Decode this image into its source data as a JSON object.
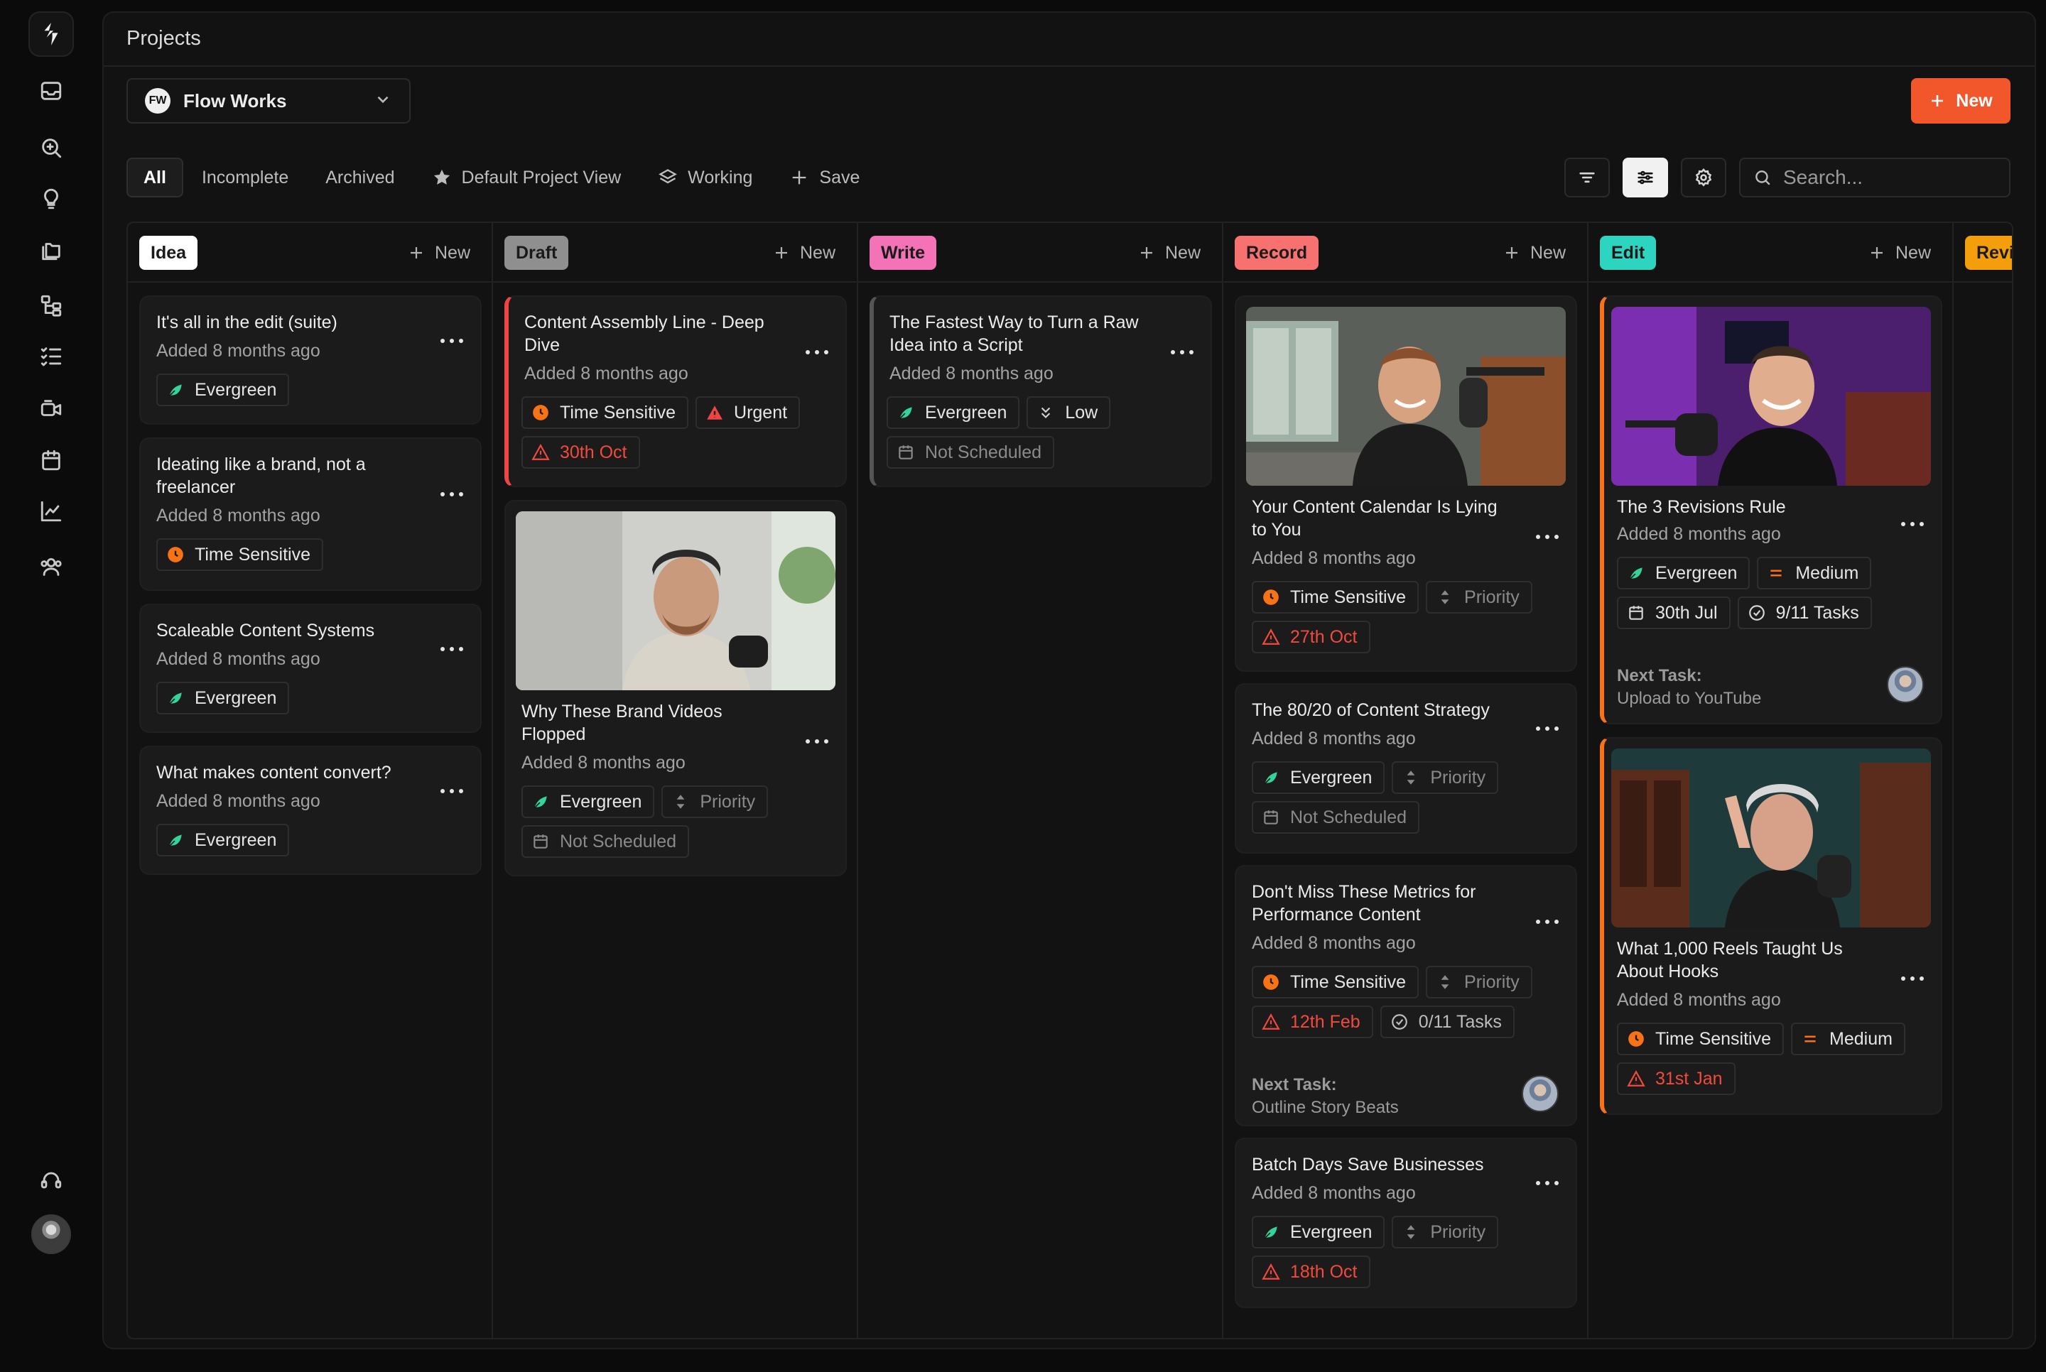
{
  "app": {
    "title": "Projects"
  },
  "workspace": {
    "logo_text": "FW",
    "name": "Flow Works"
  },
  "actions": {
    "new_label": "New"
  },
  "tabs": [
    {
      "label": "All",
      "active": true
    },
    {
      "label": "Incomplete"
    },
    {
      "label": "Archived"
    },
    {
      "label": "Default Project View",
      "icon": "star-icon"
    },
    {
      "label": "Working",
      "icon": "layers-icon"
    },
    {
      "label": "Save",
      "icon": "plus-icon"
    }
  ],
  "search": {
    "placeholder": "Search..."
  },
  "board": {
    "new_label": "New",
    "columns": [
      {
        "name": "Idea",
        "color": "#ffffff"
      },
      {
        "name": "Draft",
        "color": "#8f8f8f"
      },
      {
        "name": "Write",
        "color": "#f472b6"
      },
      {
        "name": "Record",
        "color": "#f87171"
      },
      {
        "name": "Edit",
        "color": "#2dd4bf"
      },
      {
        "name": "Revi",
        "color": "#f59e0b"
      }
    ]
  },
  "cards": {
    "idea": [
      {
        "title": "It's all in the edit (suite)",
        "added": "Added 8 months ago",
        "chips": [
          "Evergreen"
        ]
      },
      {
        "title": "Ideating like a brand, not a freelancer",
        "added": "Added 8 months ago",
        "chips": [
          "Time Sensitive"
        ]
      },
      {
        "title": "Scaleable Content Systems",
        "added": "Added 8 months ago",
        "chips": [
          "Evergreen"
        ]
      },
      {
        "title": "What makes content convert?",
        "added": "Added 8 months ago",
        "chips": [
          "Evergreen"
        ]
      }
    ],
    "draft": [
      {
        "title": "Content Assembly Line - Deep Dive",
        "added": "Added 8 months ago",
        "chips": [
          "Time Sensitive",
          "Urgent",
          "30th Oct"
        ],
        "accent": "#ef4444"
      },
      {
        "title": "Why These Brand Videos Flopped",
        "added": "Added 8 months ago",
        "chips": [
          "Evergreen",
          "Priority",
          "Not Scheduled"
        ]
      }
    ],
    "write": [
      {
        "title": "The Fastest Way to Turn a Raw Idea into a Script",
        "added": "Added 8 months ago",
        "chips": [
          "Evergreen",
          "Low",
          "Not Scheduled"
        ],
        "accent": "#555555"
      }
    ],
    "record": [
      {
        "title": "Your Content Calendar Is Lying to You",
        "added": "Added 8 months ago",
        "chips": [
          "Time Sensitive",
          "Priority",
          "27th Oct"
        ]
      },
      {
        "title": "The 80/20 of Content Strategy",
        "added": "Added 8 months ago",
        "chips": [
          "Evergreen",
          "Priority",
          "Not Scheduled"
        ]
      },
      {
        "title": "Don't Miss These Metrics for Performance Content",
        "added": "Added 8 months ago",
        "chips": [
          "Time Sensitive",
          "Priority",
          "12th Feb",
          "0/11 Tasks"
        ],
        "next_label": "Next Task:",
        "next_task": "Outline Story Beats"
      },
      {
        "title": "Batch Days Save Businesses",
        "added": "Added 8 months ago",
        "chips": [
          "Evergreen",
          "Priority",
          "18th Oct"
        ]
      }
    ],
    "edit": [
      {
        "title": "The 3 Revisions Rule",
        "added": "Added 8 months ago",
        "chips": [
          "Evergreen",
          "Medium",
          "30th Jul",
          "9/11 Tasks"
        ],
        "next_label": "Next Task:",
        "next_task": "Upload to YouTube",
        "accent": "#f97316"
      },
      {
        "title": "What 1,000 Reels Taught Us About Hooks",
        "added": "Added 8 months ago",
        "chips": [
          "Time Sensitive",
          "Medium",
          "31st Jan"
        ],
        "accent": "#f97316"
      }
    ]
  },
  "colors": {
    "accent": "#f2562b",
    "evergreen": "#34d399",
    "time_sensitive": "#f97316",
    "urgent": "#ef4444",
    "overdue_red": "#f24a3c"
  }
}
